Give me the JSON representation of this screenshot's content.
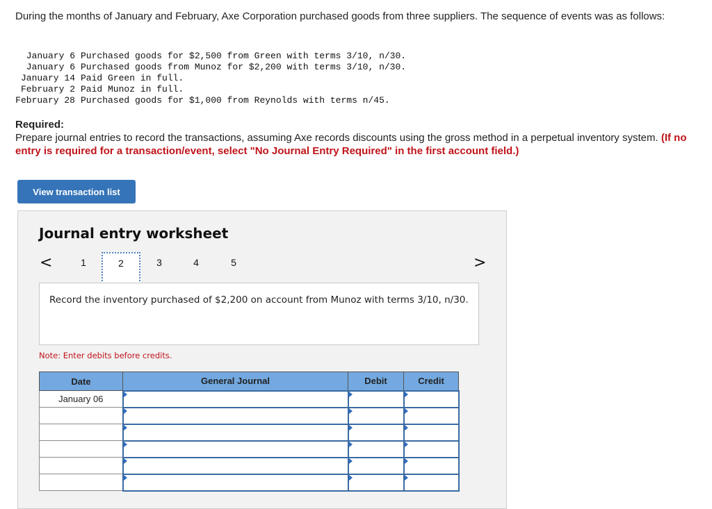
{
  "intro": "During the months of January and February, Axe Corporation purchased goods from three suppliers. The sequence of events was as follows:",
  "events": [
    {
      "date": "January 6",
      "text": "Purchased goods for $2,500 from Green with terms 3/10, n/30."
    },
    {
      "date": "January 6",
      "text": "Purchased goods from Munoz for $2,200 with terms 3/10, n/30."
    },
    {
      "date": "January 14",
      "text": "Paid Green in full."
    },
    {
      "date": "February 2",
      "text": "Paid Munoz in full."
    },
    {
      "date": "February 28",
      "text": "Purchased goods for $1,000 from Reynolds with terms n/45."
    }
  ],
  "required": {
    "title": "Required:",
    "text": "Prepare journal entries to record the transactions, assuming Axe records discounts using the gross method in a perpetual inventory system.",
    "instruction": "(If no entry is required for a transaction/event, select \"No Journal Entry Required\" in the first account field.)"
  },
  "view_button": "View transaction list",
  "worksheet": {
    "title": "Journal entry worksheet",
    "pages": [
      "1",
      "2",
      "3",
      "4",
      "5"
    ],
    "active_page": "2",
    "prev_icon": "chevron-left-icon",
    "next_icon": "chevron-right-icon",
    "prev_glyph": "<",
    "next_glyph": ">",
    "description": "Record the inventory purchased of $2,200 on account from Munoz with terms 3/10, n/30.",
    "note": "Note: Enter debits before credits.",
    "table": {
      "headers": [
        "Date",
        "General Journal",
        "Debit",
        "Credit"
      ],
      "rows": [
        {
          "date": "January 06",
          "account": "",
          "debit": "",
          "credit": ""
        },
        {
          "date": "",
          "account": "",
          "debit": "",
          "credit": ""
        },
        {
          "date": "",
          "account": "",
          "debit": "",
          "credit": ""
        },
        {
          "date": "",
          "account": "",
          "debit": "",
          "credit": ""
        },
        {
          "date": "",
          "account": "",
          "debit": "",
          "credit": ""
        },
        {
          "date": "",
          "account": "",
          "debit": "",
          "credit": ""
        }
      ]
    }
  },
  "colors": {
    "button": "#3574b8",
    "table_header": "#73a9e0",
    "input_border": "#3a6aa2",
    "warning_red": "#c0141a",
    "panel_bg": "#f2f2f2"
  }
}
